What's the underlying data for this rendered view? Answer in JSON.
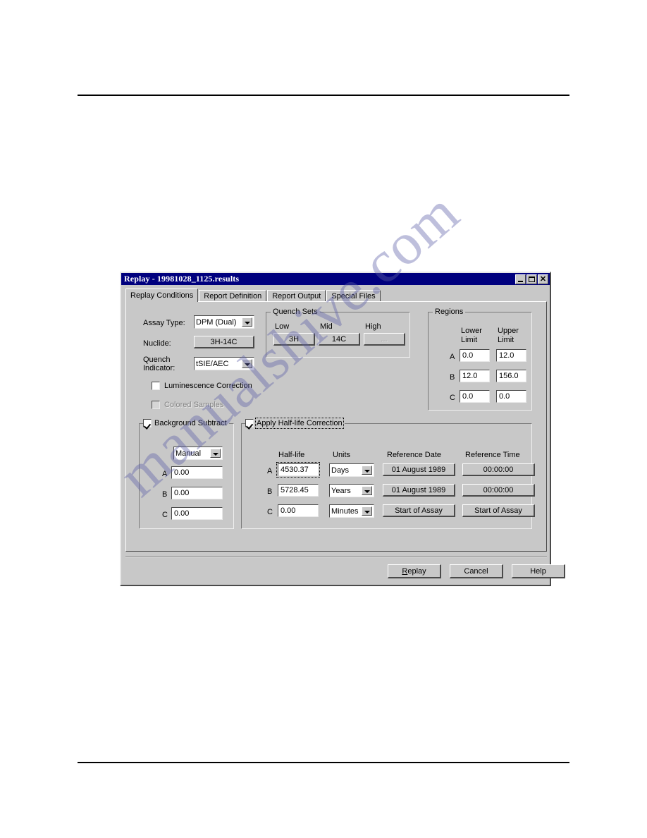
{
  "page": {
    "rules": [
      "top-rule",
      "bottom-rule"
    ],
    "watermark": "manualshive.com"
  },
  "dialog": {
    "title": "Replay - 19981028_1125.results",
    "titlebar_buttons": [
      {
        "name": "minimize",
        "glyph": "_"
      },
      {
        "name": "maximize",
        "glyph": "□"
      },
      {
        "name": "close",
        "glyph": "✕"
      }
    ],
    "tabs": [
      {
        "label": "Replay Conditions",
        "active": true
      },
      {
        "label": "Report Definition",
        "active": false
      },
      {
        "label": "Report Output",
        "active": false
      },
      {
        "label": "Special Files",
        "active": false
      }
    ],
    "form": {
      "assay_type_label": "Assay Type:",
      "assay_type_value": "DPM (Dual)",
      "nuclide_label": "Nuclide:",
      "nuclide_value": "3H-14C",
      "quench_indicator_label_line1": "Quench",
      "quench_indicator_label_line2": "Indicator:",
      "quench_indicator_value": "tSIE/AEC",
      "luminescence_correction_label": "Luminescence Correction",
      "luminescence_correction_checked": false,
      "colored_samples_label": "Colored Samples",
      "colored_samples_checked": false,
      "colored_samples_enabled": false
    },
    "quench_sets": {
      "title": "Quench Sets",
      "columns": [
        "Low",
        "Mid",
        "High"
      ],
      "values": [
        "3H",
        "14C",
        "..."
      ],
      "high_enabled": false
    },
    "regions": {
      "title": "Regions",
      "col_lower_line1": "Lower",
      "col_lower_line2": "Limit",
      "col_upper_line1": "Upper",
      "col_upper_line2": "Limit",
      "rows": [
        {
          "label": "A",
          "lower": "0.0",
          "upper": "12.0"
        },
        {
          "label": "B",
          "lower": "12.0",
          "upper": "156.0"
        },
        {
          "label": "C",
          "lower": "0.0",
          "upper": "0.0"
        }
      ]
    },
    "background_subtract": {
      "title": "Background Subtract",
      "checked": true,
      "mode": "Manual",
      "rows": [
        {
          "label": "A",
          "value": "0.00"
        },
        {
          "label": "B",
          "value": "0.00"
        },
        {
          "label": "C",
          "value": "0.00"
        }
      ]
    },
    "half_life": {
      "title": "Apply Half-life Correction",
      "checked": true,
      "headers": {
        "half_life": "Half-life",
        "units": "Units",
        "reference_date": "Reference Date",
        "reference_time": "Reference Time"
      },
      "rows": [
        {
          "label": "A",
          "half_life": "4530.37",
          "units": "Days",
          "ref_date": "01 August 1989",
          "ref_time": "00:00:00"
        },
        {
          "label": "B",
          "half_life": "5728.45",
          "units": "Years",
          "ref_date": "01 August 1989",
          "ref_time": "00:00:00"
        },
        {
          "label": "C",
          "half_life": "0.00",
          "units": "Minutes",
          "ref_date": "Start of Assay",
          "ref_time": "Start of Assay"
        }
      ]
    },
    "buttons": {
      "replay": "Replay",
      "replay_accel": "R",
      "replay_rest": "eplay",
      "cancel": "Cancel",
      "help": "Help"
    },
    "colors": {
      "titlebar": "#00007e",
      "face": "#c8c8c8",
      "field": "#ffffff",
      "watermark": "#5c60a8"
    }
  }
}
